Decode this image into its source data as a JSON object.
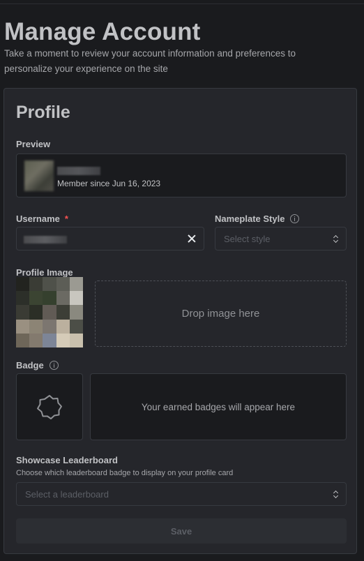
{
  "page": {
    "title": "Manage Account",
    "subtitle": "Take a moment to review your account information and preferences to personalize your experience on the site"
  },
  "profile": {
    "title": "Profile",
    "preview": {
      "label": "Preview",
      "member_since": "Member since Jun 16, 2023"
    },
    "username": {
      "label": "Username",
      "required_mark": "*"
    },
    "nameplate": {
      "label": "Nameplate Style",
      "placeholder": "Select style"
    },
    "profile_image": {
      "label": "Profile Image",
      "drop_text": "Drop image here"
    },
    "badge": {
      "label": "Badge",
      "empty_text": "Your earned badges will appear here"
    },
    "leaderboard": {
      "label": "Showcase Leaderboard",
      "help": "Choose which leaderboard badge to display on your profile card",
      "placeholder": "Select a leaderboard"
    },
    "save_label": "Save"
  },
  "icons": {
    "clear": "close-icon",
    "select": "chevron-up-down-icon",
    "info": "info-icon",
    "badge": "badge-outline-icon"
  },
  "colors": {
    "background": "#1a1b1e",
    "card": "#25262b",
    "border": "#373a40",
    "required": "#fa5252"
  }
}
